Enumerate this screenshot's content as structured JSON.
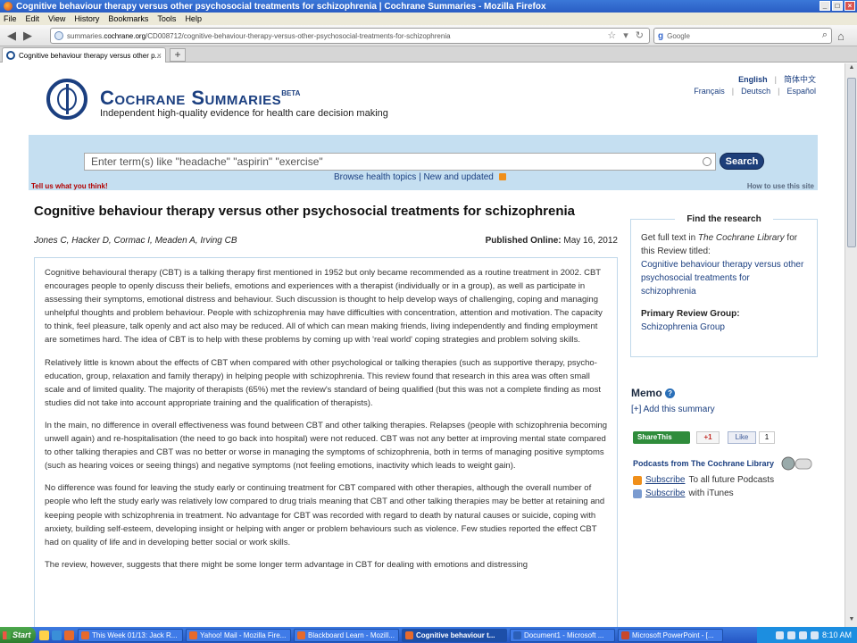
{
  "window": {
    "title": "Cognitive behaviour therapy versus other psychosocial treatments for schizophrenia | Cochrane Summaries - Mozilla Firefox"
  },
  "menu": [
    "File",
    "Edit",
    "View",
    "History",
    "Bookmarks",
    "Tools",
    "Help"
  ],
  "address": {
    "url_prefix": "summaries.",
    "url_host": "cochrane.org",
    "url_path": "/CD008712/cognitive-behaviour-therapy-versus-other-psychosocial-treatments-for-schizophrenia"
  },
  "search_engine": {
    "label": "Google"
  },
  "tab": {
    "title": "Cognitive behaviour therapy versus other p..."
  },
  "site": {
    "brand": "Cochrane Summaries",
    "brand_sup": "BETA",
    "tagline": "Independent high-quality evidence for health care decision making",
    "languages": {
      "row1": [
        "English",
        "简体中文"
      ],
      "row2": [
        "Français",
        "Deutsch",
        "Español"
      ]
    }
  },
  "search": {
    "placeholder": "Enter term(s) like \"headache\" \"aspirin\" \"exercise\"",
    "button": "Search",
    "browse": "Browse health topics",
    "separator": "|",
    "new": "New and updated",
    "feedback": "Tell us what you think!",
    "howto": "How to use this site"
  },
  "article": {
    "title": "Cognitive behaviour therapy versus other psychosocial treatments for schizophrenia",
    "authors": "Jones C, Hacker D, Cormac I, Meaden A, Irving CB",
    "published_label": "Published Online:",
    "published_date": "May 16, 2012",
    "paragraphs": [
      "Cognitive behavioural therapy (CBT) is a talking therapy first mentioned in 1952 but only became recommended as a routine treatment in 2002. CBT encourages people to openly discuss their beliefs, emotions and experiences with a therapist (individually or in a group), as well as participate in assessing their symptoms, emotional distress and behaviour. Such discussion is thought to help develop ways of challenging, coping and managing unhelpful thoughts and problem behaviour. People with schizophrenia may have difficulties with concentration, attention and motivation. The capacity to think, feel pleasure, talk openly and act also may be reduced. All of which can mean making friends, living independently and finding employment are sometimes hard. The idea of CBT is to help with these problems by coming up with 'real world' coping strategies and problem solving skills.",
      "Relatively little is known about the effects of CBT when compared with other psychological or talking therapies (such as supportive therapy, psycho- education, group, relaxation and family therapy) in helping people with schizophrenia. This review found that research in this area was often small scale and of limited quality. The majority of therapists (65%) met the review's standard of being qualified (but this was not a complete finding as most studies did not take into account appropriate training and the qualification of therapists).",
      "In the main, no difference in overall effectiveness was found between CBT and other talking therapies. Relapses (people with schizophrenia becoming unwell again) and re-hospitalisation (the need to go back into hospital) were not reduced. CBT was not any better at improving mental state compared to other talking therapies and CBT was no better or worse in managing the symptoms of schizophrenia, both in terms of managing positive symptoms (such as hearing voices or seeing things) and negative symptoms (not feeling emotions, inactivity which leads to weight gain).",
      "No difference was found for leaving the study early or continuing treatment for CBT compared with other therapies, although the overall number of people who left the study early was relatively low compared to drug trials meaning that CBT and other talking therapies may be better at retaining and keeping people with schizophrenia in treatment. No advantage for CBT was recorded with regard to death by natural causes or suicide, coping with anxiety, building self-esteem, developing insight or helping with anger or problem behaviours such as violence. Few studies reported the effect CBT had on quality of life and in developing better social or work skills.",
      "The review, however, suggests that there might be some longer term advantage in CBT for dealing with emotions and distressing"
    ]
  },
  "sidebar": {
    "research_title": "Find the research",
    "fulltext_prefix": "Get full text in",
    "library_name": "The Cochrane Library",
    "fulltext_suffix": "for this Review titled:",
    "review_link": "Cognitive behaviour therapy versus other psychosocial treatments for schizophrenia",
    "group_label": "Primary Review Group:",
    "group_link": "Schizophrenia Group",
    "memo_title": "Memo",
    "memo_help": "?",
    "memo_add": "[+] Add this summary",
    "share": "ShareThis",
    "gplus": "+1",
    "fb_like": "Like",
    "fb_count": "1",
    "podcasts_title": "Podcasts from The Cochrane Library",
    "subscribe1_link": "Subscribe",
    "subscribe1_text": "To all future Podcasts",
    "subscribe2_link": "Subscribe",
    "subscribe2_text": "with iTunes"
  },
  "taskbar": {
    "start": "Start",
    "items": [
      "This Week 01/13: Jack R...",
      "Yahoo! Mail - Mozilla Fire...",
      "Blackboard Learn - Mozill...",
      "Cognitive behaviour t...",
      "Document1 - Microsoft ...",
      "Microsoft PowerPoint - [..."
    ],
    "clock": "8:10 AM"
  }
}
